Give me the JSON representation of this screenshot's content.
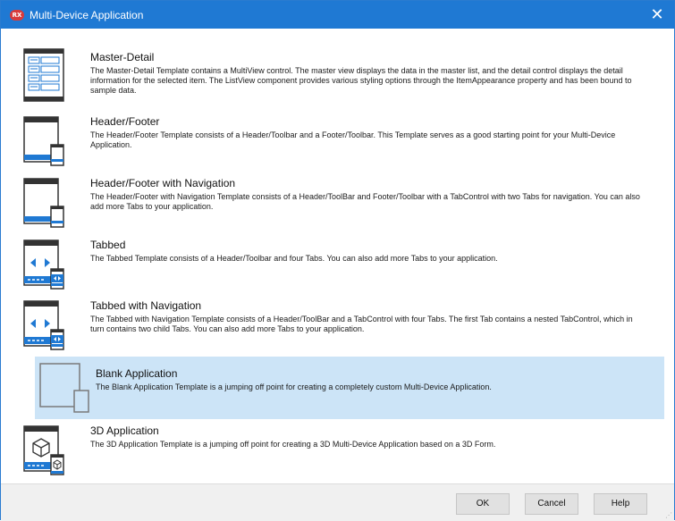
{
  "window": {
    "title": "Multi-Device Application",
    "icon": "RX"
  },
  "templates": [
    {
      "title": "Master-Detail",
      "desc": "The Master-Detail Template contains a MultiView control. The master view displays the data in the master list, and the detail control displays the detail information for the selected item. The ListView component provides various styling options through the ItemAppearance property and has been bound to sample data.",
      "icon": "master-detail-icon"
    },
    {
      "title": "Header/Footer",
      "desc": "The Header/Footer Template consists of a Header/Toolbar and a Footer/Toolbar. This Template serves as a good starting point for your Multi-Device Application.",
      "icon": "header-footer-icon"
    },
    {
      "title": "Header/Footer with Navigation",
      "desc": "The Header/Footer with Navigation Template consists of a Header/ToolBar and Footer/Toolbar with a TabControl with two Tabs for navigation.  You can also add more Tabs to your application.",
      "icon": "header-footer-nav-icon"
    },
    {
      "title": "Tabbed",
      "desc": "The Tabbed Template consists of a Header/Toolbar and four Tabs.  You can also add more Tabs to your application.",
      "icon": "tabbed-icon"
    },
    {
      "title": "Tabbed with Navigation",
      "desc": "The Tabbed with Navigation Template consists of a Header/ToolBar and a TabControl with four Tabs. The first Tab contains a nested TabControl, which in turn contains two child Tabs. You can also add more Tabs to your application.",
      "icon": "tabbed-nav-icon"
    },
    {
      "title": "Blank Application",
      "desc": "The Blank Application Template is a jumping off point for creating a completely custom Multi-Device Application.",
      "icon": "blank-app-icon",
      "selected": true
    },
    {
      "title": "3D Application",
      "desc": "The 3D Application Template is a jumping off point for creating a 3D Multi-Device Application based on a 3D Form.",
      "icon": "3d-app-icon"
    }
  ],
  "buttons": {
    "ok": "OK",
    "cancel": "Cancel",
    "help": "Help"
  },
  "colors": {
    "titlebar": "#1f79d3",
    "selection": "#cce4f7",
    "accent_blue": "#1f79d3"
  }
}
